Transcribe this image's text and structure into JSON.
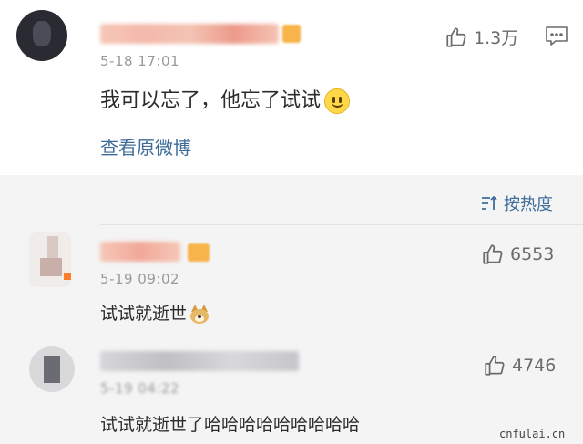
{
  "post": {
    "author_name": "",
    "timestamp": "5-18 17:01",
    "content": "我可以忘了，他忘了试试",
    "emoji": "smile-emoji",
    "like_count": "1.3万",
    "view_original_link": "查看原微博"
  },
  "sort": {
    "label": "按热度"
  },
  "replies": [
    {
      "timestamp": "5-19 09:02",
      "content": "试试就逝世",
      "emoji": "doge-emoji",
      "like_count": "6553"
    },
    {
      "timestamp": "5-19 04:22",
      "content": "试试就逝世了哈哈哈哈哈哈哈哈哈",
      "like_count": "4746"
    }
  ],
  "watermark": "cnfulai.cn",
  "colors": {
    "link": "#3e6d9a",
    "background": "#f4f4f4",
    "card": "#ffffff",
    "text": "#2b2b2b",
    "muted": "#9a9a9a",
    "vip_badge": "#f7b44a"
  }
}
